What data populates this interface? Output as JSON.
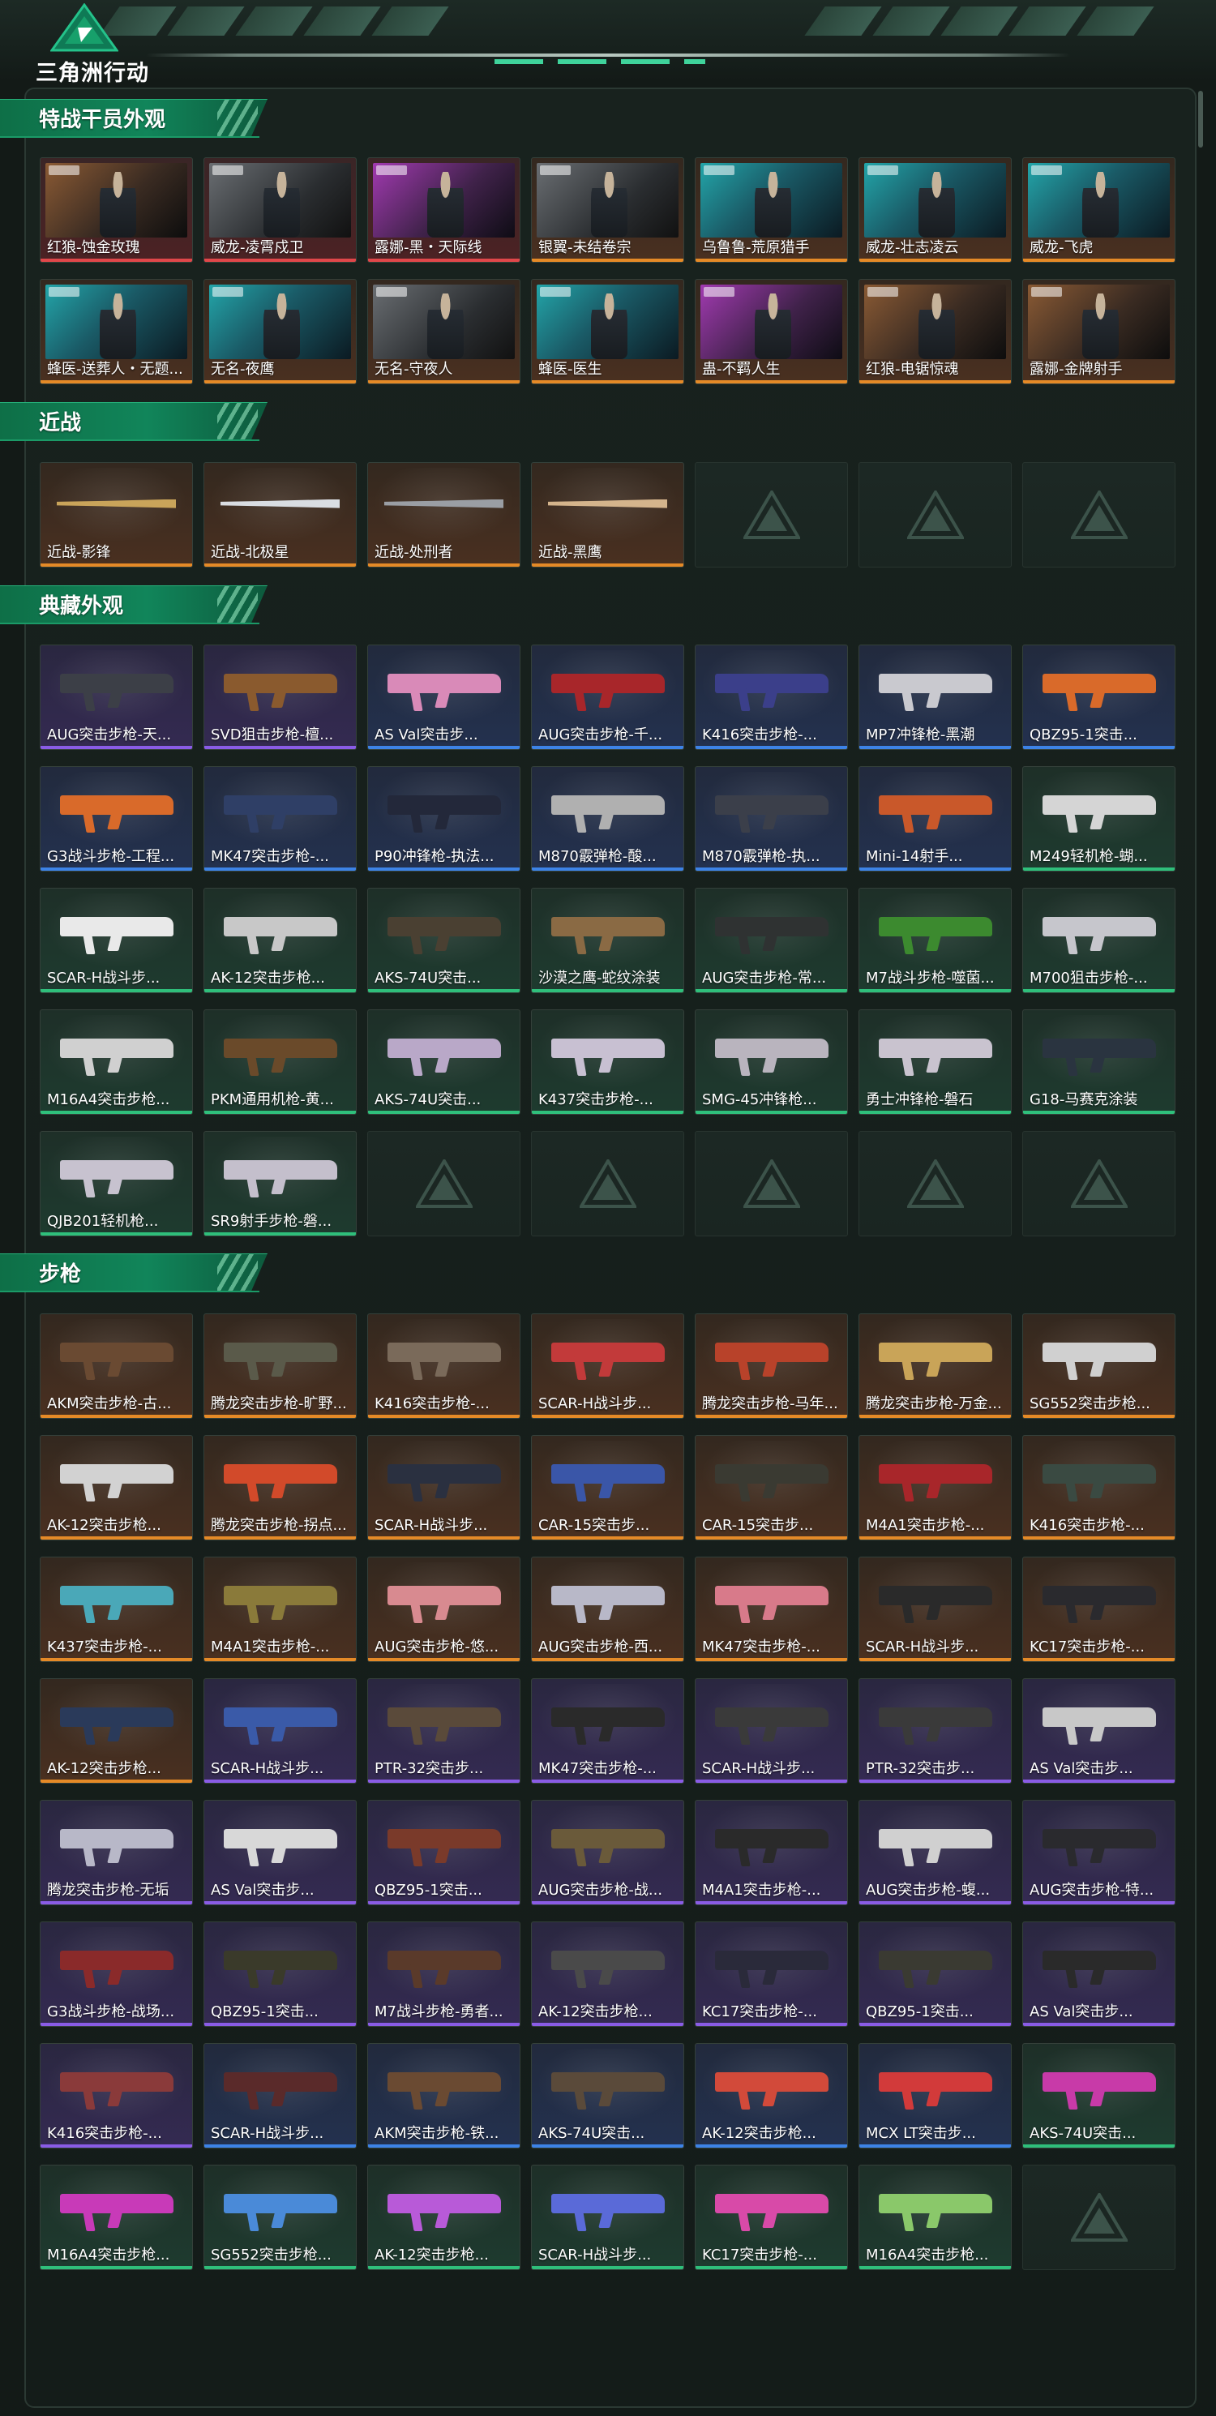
{
  "app": {
    "title": "三角洲行动"
  },
  "sections": [
    {
      "title": "特战干员外观",
      "items": [
        {
          "label": "红狼-蚀金玫瑰",
          "rarity": "red",
          "kind": "operator",
          "tone": "warm"
        },
        {
          "label": "威龙-凌霄戍卫",
          "rarity": "red",
          "kind": "operator",
          "tone": "gray"
        },
        {
          "label": "露娜-黑・天际线",
          "rarity": "red",
          "kind": "operator",
          "tone": "pink"
        },
        {
          "label": "银翼-未结卷宗",
          "rarity": "orange",
          "kind": "operator",
          "tone": "gray"
        },
        {
          "label": "乌鲁鲁-荒原猎手",
          "rarity": "orange",
          "kind": "operator",
          "tone": "teal"
        },
        {
          "label": "威龙-壮志凌云",
          "rarity": "orange",
          "kind": "operator",
          "tone": "teal"
        },
        {
          "label": "威龙-飞虎",
          "rarity": "orange",
          "kind": "operator",
          "tone": "teal"
        },
        {
          "label": "蜂医-送葬人・无题...",
          "rarity": "orange",
          "kind": "operator",
          "tone": "teal"
        },
        {
          "label": "无名-夜鹰",
          "rarity": "orange",
          "kind": "operator",
          "tone": "teal"
        },
        {
          "label": "无名-守夜人",
          "rarity": "orange",
          "kind": "operator",
          "tone": "gray"
        },
        {
          "label": "蜂医-医生",
          "rarity": "orange",
          "kind": "operator",
          "tone": "teal"
        },
        {
          "label": "蛊-不羁人生",
          "rarity": "orange",
          "kind": "operator",
          "tone": "pink"
        },
        {
          "label": "红狼-电锯惊魂",
          "rarity": "orange",
          "kind": "operator",
          "tone": "warm"
        },
        {
          "label": "露娜-金牌射手",
          "rarity": "orange",
          "kind": "operator",
          "tone": "warm"
        }
      ]
    },
    {
      "title": "近战",
      "items": [
        {
          "label": "近战-影锋",
          "rarity": "orange",
          "kind": "knife",
          "color": "#c9a45a"
        },
        {
          "label": "近战-北极星",
          "rarity": "orange",
          "kind": "knife",
          "color": "#d9dde2"
        },
        {
          "label": "近战-处刑者",
          "rarity": "orange",
          "kind": "knife",
          "color": "#9a9ea4"
        },
        {
          "label": "近战-黑鹰",
          "rarity": "orange",
          "kind": "knife",
          "color": "#d4b48c"
        },
        {
          "label": "",
          "kind": "empty"
        },
        {
          "label": "",
          "kind": "empty"
        },
        {
          "label": "",
          "kind": "empty"
        }
      ]
    },
    {
      "title": "典藏外观",
      "items": [
        {
          "label": "AUG突击步枪-天...",
          "rarity": "purple",
          "kind": "gun",
          "color": "#3c3f47"
        },
        {
          "label": "SVD狙击步枪-檀...",
          "rarity": "purple",
          "kind": "gun",
          "color": "#8a5a2e"
        },
        {
          "label": "AS Val突击步...",
          "rarity": "blue",
          "kind": "gun",
          "color": "#d98ab8"
        },
        {
          "label": "AUG突击步枪-千...",
          "rarity": "blue",
          "kind": "gun",
          "color": "#a8262a"
        },
        {
          "label": "K416突击步枪-...",
          "rarity": "blue",
          "kind": "gun",
          "color": "#3b3f8a"
        },
        {
          "label": "MP7冲锋枪-黑潮",
          "rarity": "blue",
          "kind": "gun",
          "color": "#c9c9cf"
        },
        {
          "label": "QBZ95-1突击...",
          "rarity": "blue",
          "kind": "gun",
          "color": "#d96a2a"
        },
        {
          "label": "G3战斗步枪-工程...",
          "rarity": "blue",
          "kind": "gun",
          "color": "#d96a2a"
        },
        {
          "label": "MK47突击步枪-...",
          "rarity": "blue",
          "kind": "gun",
          "color": "#2f3f66"
        },
        {
          "label": "P90冲锋枪-执法...",
          "rarity": "blue",
          "kind": "gun",
          "color": "#23283a"
        },
        {
          "label": "M870霰弹枪-酸...",
          "rarity": "blue",
          "kind": "gun",
          "color": "#b0b0b0"
        },
        {
          "label": "M870霰弹枪-执...",
          "rarity": "blue",
          "kind": "gun",
          "color": "#3b3f4a"
        },
        {
          "label": "Mini-14射手...",
          "rarity": "blue",
          "kind": "gun",
          "color": "#c9582a"
        },
        {
          "label": "M249轻机枪-蝴...",
          "rarity": "green",
          "kind": "gun",
          "color": "#d5d5d5"
        },
        {
          "label": "SCAR-H战斗步...",
          "rarity": "green",
          "kind": "gun",
          "color": "#e9e9e9"
        },
        {
          "label": "AK-12突击步枪...",
          "rarity": "green",
          "kind": "gun",
          "color": "#c8c8c8"
        },
        {
          "label": "AKS-74U突击...",
          "rarity": "green",
          "kind": "gun",
          "color": "#4a4032"
        },
        {
          "label": "沙漠之鹰-蛇纹涂装",
          "rarity": "green",
          "kind": "gun",
          "color": "#8a6a44"
        },
        {
          "label": "AUG突击步枪-常...",
          "rarity": "green",
          "kind": "gun",
          "color": "#2f3232"
        },
        {
          "label": "M7战斗步枪-噬菌...",
          "rarity": "green",
          "kind": "gun",
          "color": "#3c8a2f"
        },
        {
          "label": "M700狙击步枪-...",
          "rarity": "green",
          "kind": "gun",
          "color": "#c6c6cc"
        },
        {
          "label": "M16A4突击步枪...",
          "rarity": "green",
          "kind": "gun",
          "color": "#d0d0d0"
        },
        {
          "label": "PKM通用机枪-黄...",
          "rarity": "green",
          "kind": "gun",
          "color": "#6a4a2a"
        },
        {
          "label": "AKS-74U突击...",
          "rarity": "green",
          "kind": "gun",
          "color": "#b9a8c8"
        },
        {
          "label": "K437突击步枪-...",
          "rarity": "green",
          "kind": "gun",
          "color": "#c8c0d2"
        },
        {
          "label": "SMG-45冲锋枪...",
          "rarity": "green",
          "kind": "gun",
          "color": "#b9b4be"
        },
        {
          "label": "勇士冲锋枪-磐石",
          "rarity": "green",
          "kind": "gun",
          "color": "#c9c3cf"
        },
        {
          "label": "G18-马赛克涂装",
          "rarity": "green",
          "kind": "gun",
          "color": "#2a3440"
        },
        {
          "label": "QJB201轻机枪...",
          "rarity": "green",
          "kind": "gun",
          "color": "#c7c2cf"
        },
        {
          "label": "SR9射手步枪-磐...",
          "rarity": "green",
          "kind": "gun",
          "color": "#c4bfcc"
        },
        {
          "label": "",
          "kind": "empty"
        },
        {
          "label": "",
          "kind": "empty"
        },
        {
          "label": "",
          "kind": "empty"
        },
        {
          "label": "",
          "kind": "empty"
        },
        {
          "label": "",
          "kind": "empty"
        }
      ]
    },
    {
      "title": "步枪",
      "items": [
        {
          "label": "AKM突击步枪-古...",
          "rarity": "orange",
          "kind": "gun",
          "color": "#6a4a32"
        },
        {
          "label": "腾龙突击步枪-旷野...",
          "rarity": "orange",
          "kind": "gun",
          "color": "#5a5a4a"
        },
        {
          "label": "K416突击步枪-...",
          "rarity": "orange",
          "kind": "gun",
          "color": "#7a6a5a"
        },
        {
          "label": "SCAR-H战斗步...",
          "rarity": "orange",
          "kind": "gun",
          "color": "#c23a3a"
        },
        {
          "label": "腾龙突击步枪-马年...",
          "rarity": "orange",
          "kind": "gun",
          "color": "#b8422a"
        },
        {
          "label": "腾龙突击步枪-万金...",
          "rarity": "orange",
          "kind": "gun",
          "color": "#c9a458"
        },
        {
          "label": "SG552突击步枪...",
          "rarity": "orange",
          "kind": "gun",
          "color": "#d0d0d0"
        },
        {
          "label": "AK-12突击步枪...",
          "rarity": "orange",
          "kind": "gun",
          "color": "#d2d2d2"
        },
        {
          "label": "腾龙突击步枪-拐点...",
          "rarity": "orange",
          "kind": "gun",
          "color": "#d24a2a"
        },
        {
          "label": "SCAR-H战斗步...",
          "rarity": "orange",
          "kind": "gun",
          "color": "#2a3040"
        },
        {
          "label": "CAR-15突击步...",
          "rarity": "orange",
          "kind": "gun",
          "color": "#3a56a8"
        },
        {
          "label": "CAR-15突击步...",
          "rarity": "orange",
          "kind": "gun",
          "color": "#3a3a32"
        },
        {
          "label": "M4A1突击步枪-...",
          "rarity": "orange",
          "kind": "gun",
          "color": "#a8262a"
        },
        {
          "label": "K416突击步枪-...",
          "rarity": "orange",
          "kind": "gun",
          "color": "#3a4a42"
        },
        {
          "label": "K437突击步枪-...",
          "rarity": "orange",
          "kind": "gun",
          "color": "#4aa8b8"
        },
        {
          "label": "M4A1突击步枪-...",
          "rarity": "orange",
          "kind": "gun",
          "color": "#8a7a3a"
        },
        {
          "label": "AUG突击步枪-悠...",
          "rarity": "orange",
          "kind": "gun",
          "color": "#d88a90"
        },
        {
          "label": "AUG突击步枪-西...",
          "rarity": "orange",
          "kind": "gun",
          "color": "#b8b8c8"
        },
        {
          "label": "MK47突击步枪-...",
          "rarity": "orange",
          "kind": "gun",
          "color": "#d87a8a"
        },
        {
          "label": "SCAR-H战斗步...",
          "rarity": "orange",
          "kind": "gun",
          "color": "#2a2a2a"
        },
        {
          "label": "KC17突击步枪-...",
          "rarity": "orange",
          "kind": "gun",
          "color": "#2a2a2e"
        },
        {
          "label": "AK-12突击步枪...",
          "rarity": "orange",
          "kind": "gun",
          "color": "#2a3a5a"
        },
        {
          "label": "SCAR-H战斗步...",
          "rarity": "purple",
          "kind": "gun",
          "color": "#3a5aa8"
        },
        {
          "label": "PTR-32突击步...",
          "rarity": "purple",
          "kind": "gun",
          "color": "#5a4a3a"
        },
        {
          "label": "MK47突击步枪-...",
          "rarity": "purple",
          "kind": "gun",
          "color": "#2a2a2a"
        },
        {
          "label": "SCAR-H战斗步...",
          "rarity": "purple",
          "kind": "gun",
          "color": "#3a3a3a"
        },
        {
          "label": "PTR-32突击步...",
          "rarity": "purple",
          "kind": "gun",
          "color": "#3a3a3a"
        },
        {
          "label": "AS Val突击步...",
          "rarity": "purple",
          "kind": "gun",
          "color": "#c8c8c8"
        },
        {
          "label": "腾龙突击步枪-无垢",
          "rarity": "purple",
          "kind": "gun",
          "color": "#b8b8c8"
        },
        {
          "label": "AS Val突击步...",
          "rarity": "purple",
          "kind": "gun",
          "color": "#d8d8d8"
        },
        {
          "label": "QBZ95-1突击...",
          "rarity": "purple",
          "kind": "gun",
          "color": "#7a3a2a"
        },
        {
          "label": "AUG突击步枪-战...",
          "rarity": "purple",
          "kind": "gun",
          "color": "#6a5a3a"
        },
        {
          "label": "M4A1突击步枪-...",
          "rarity": "purple",
          "kind": "gun",
          "color": "#2a2a2a"
        },
        {
          "label": "AUG突击步枪-蝮...",
          "rarity": "purple",
          "kind": "gun",
          "color": "#d0d0d0"
        },
        {
          "label": "AUG突击步枪-特...",
          "rarity": "purple",
          "kind": "gun",
          "color": "#2a2a2e"
        },
        {
          "label": "G3战斗步枪-战场...",
          "rarity": "purple",
          "kind": "gun",
          "color": "#8a2a2a"
        },
        {
          "label": "QBZ95-1突击...",
          "rarity": "purple",
          "kind": "gun",
          "color": "#3a3a2a"
        },
        {
          "label": "M7战斗步枪-勇者...",
          "rarity": "purple",
          "kind": "gun",
          "color": "#5a3a2a"
        },
        {
          "label": "AK-12突击步枪...",
          "rarity": "purple",
          "kind": "gun",
          "color": "#4a4a4a"
        },
        {
          "label": "KC17突击步枪-...",
          "rarity": "purple",
          "kind": "gun",
          "color": "#2a2a3a"
        },
        {
          "label": "QBZ95-1突击...",
          "rarity": "purple",
          "kind": "gun",
          "color": "#3a3a32"
        },
        {
          "label": "AS Val突击步...",
          "rarity": "purple",
          "kind": "gun",
          "color": "#2a2a2a"
        },
        {
          "label": "K416突击步枪-...",
          "rarity": "purple",
          "kind": "gun",
          "color": "#8a3a3a"
        },
        {
          "label": "SCAR-H战斗步...",
          "rarity": "blue",
          "kind": "gun",
          "color": "#5a2a2a"
        },
        {
          "label": "AKM突击步枪-铁...",
          "rarity": "blue",
          "kind": "gun",
          "color": "#6a4a32"
        },
        {
          "label": "AKS-74U突击...",
          "rarity": "blue",
          "kind": "gun",
          "color": "#5a4a3a"
        },
        {
          "label": "AK-12突击步枪...",
          "rarity": "blue",
          "kind": "gun",
          "color": "#d24a3a"
        },
        {
          "label": "MCX LT突击步...",
          "rarity": "blue",
          "kind": "gun",
          "color": "#d23a3a"
        },
        {
          "label": "AKS-74U突击...",
          "rarity": "green",
          "kind": "gun",
          "color": "#c83aa8"
        },
        {
          "label": "M16A4突击步枪...",
          "rarity": "green",
          "kind": "gun",
          "color": "#c83ab8"
        },
        {
          "label": "SG552突击步枪...",
          "rarity": "green",
          "kind": "gun",
          "color": "#4a8ad8"
        },
        {
          "label": "AK-12突击步枪...",
          "rarity": "green",
          "kind": "gun",
          "color": "#b85ad8"
        },
        {
          "label": "SCAR-H战斗步...",
          "rarity": "green",
          "kind": "gun",
          "color": "#5a6ad8"
        },
        {
          "label": "KC17突击步枪-...",
          "rarity": "green",
          "kind": "gun",
          "color": "#d84aa8"
        },
        {
          "label": "M16A4突击步枪...",
          "rarity": "green",
          "kind": "gun",
          "color": "#8ac86a"
        },
        {
          "label": "",
          "kind": "empty"
        }
      ]
    }
  ]
}
